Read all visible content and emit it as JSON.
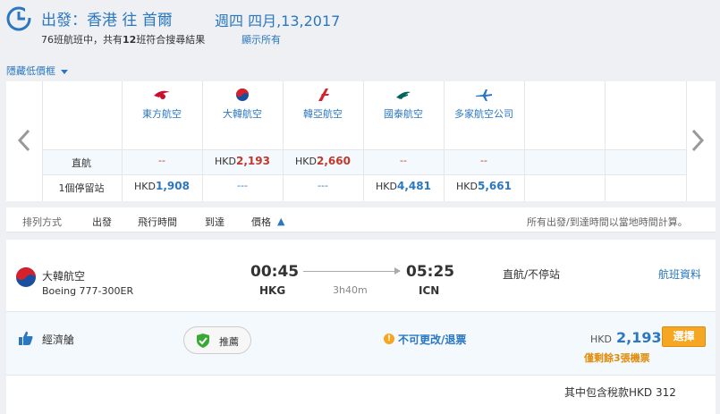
{
  "header": {
    "depart_label": "出發：",
    "origin": "香港",
    "to_word": "往",
    "destination": "首爾",
    "date": "週四 四月,13,2017",
    "results_prefix": "76班航班中，共有",
    "results_count": "12",
    "results_suffix": "班符合搜尋結果",
    "show_all": "顯示所有"
  },
  "hide_toggle": "隱藏低價框",
  "matrix": {
    "airlines": [
      {
        "name": "東方航空",
        "icon": "china-eastern-icon"
      },
      {
        "name": "大韓航空",
        "icon": "korean-air-icon"
      },
      {
        "name": "韓亞航空",
        "icon": "asiana-icon"
      },
      {
        "name": "國泰航空",
        "icon": "cathay-icon"
      },
      {
        "name": "多家航空公司",
        "icon": "multi-airline-icon"
      }
    ],
    "rows": [
      {
        "label": "直航",
        "cells": [
          {
            "currency": "",
            "amount": "--"
          },
          {
            "currency": "HKD",
            "amount": "2,193"
          },
          {
            "currency": "HKD",
            "amount": "2,660"
          },
          {
            "currency": "",
            "amount": "--"
          },
          {
            "currency": "",
            "amount": "--"
          }
        ]
      },
      {
        "label": "1個停留站",
        "cells": [
          {
            "currency": "HKD",
            "amount": "1,908"
          },
          {
            "currency": "",
            "amount": "---"
          },
          {
            "currency": "",
            "amount": "---"
          },
          {
            "currency": "HKD",
            "amount": "4,481"
          },
          {
            "currency": "HKD",
            "amount": "5,661"
          }
        ]
      }
    ]
  },
  "sortbar": {
    "label": "排列方式",
    "items": [
      "出發",
      "飛行時間",
      "到達",
      "價格"
    ],
    "note": "所有出發/到達時間以當地時間計算。"
  },
  "flight": {
    "airline": "大韓航空",
    "aircraft": "Boeing 777-300ER",
    "dep_time": "00:45",
    "arr_time": "05:25",
    "dep_airport": "HKG",
    "arr_airport": "ICN",
    "duration": "3h40m",
    "stops": "直航/不停站",
    "details_link": "航班資料",
    "cabin": "經濟艙",
    "recommend": "推薦",
    "fare_rule": "不可更改/退票",
    "price_currency": "HKD",
    "price": "2,193",
    "select": "選擇",
    "seats_left": "僅剩餘3張機票",
    "tax_note": "其中包含稅款HKD 312"
  },
  "colors": {
    "accent": "#2b77c0",
    "price_red": "#c0392b",
    "button_orange": "#f5a623"
  }
}
